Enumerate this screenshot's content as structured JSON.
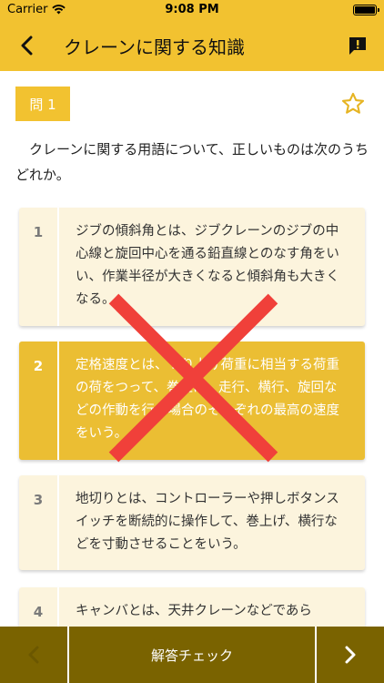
{
  "status_bar": {
    "carrier": "Carrier",
    "time": "9:08 PM"
  },
  "nav": {
    "title": "クレーンに関する知識",
    "back_icon": "chevron-left-icon",
    "report_icon": "report-icon"
  },
  "question": {
    "badge": "問 1",
    "text": "クレーンに関する用語について、正しいものは次のうちどれか。",
    "bookmark_icon": "star-outline-icon"
  },
  "choices": [
    {
      "number": "1",
      "text": "ジブの傾斜角とは、ジブクレーンのジブの中心線と旋回中心を通る鉛直線とのなす角をいい、作業半径が大きくなると傾斜角も大きくなる。",
      "selected": false
    },
    {
      "number": "2",
      "text": "定格速度とは、つり上げ荷重に相当する荷重の荷をつって、巻上げ、走行、横行、旋回などの作動を行う場合のそれぞれの最高の速度をいう。",
      "selected": true
    },
    {
      "number": "3",
      "text": "地切りとは、コントローラーや押しボタンスイッチを断続的に操作して、巻上げ、横行などを寸動させることをいう。",
      "selected": false
    },
    {
      "number": "4",
      "text": "キャンバとは、天井クレーンなどであら",
      "selected": false
    }
  ],
  "result": {
    "mark": "wrong",
    "color": "#f0403a"
  },
  "bottom_bar": {
    "check_label": "解答チェック",
    "prev_icon": "chevron-left-icon",
    "next_icon": "chevron-right-icon"
  },
  "colors": {
    "accent": "#f2c230",
    "selected_choice": "#ebbe33",
    "choice_bg": "#fcf4dd",
    "bottom_bar": "#7a6300"
  }
}
